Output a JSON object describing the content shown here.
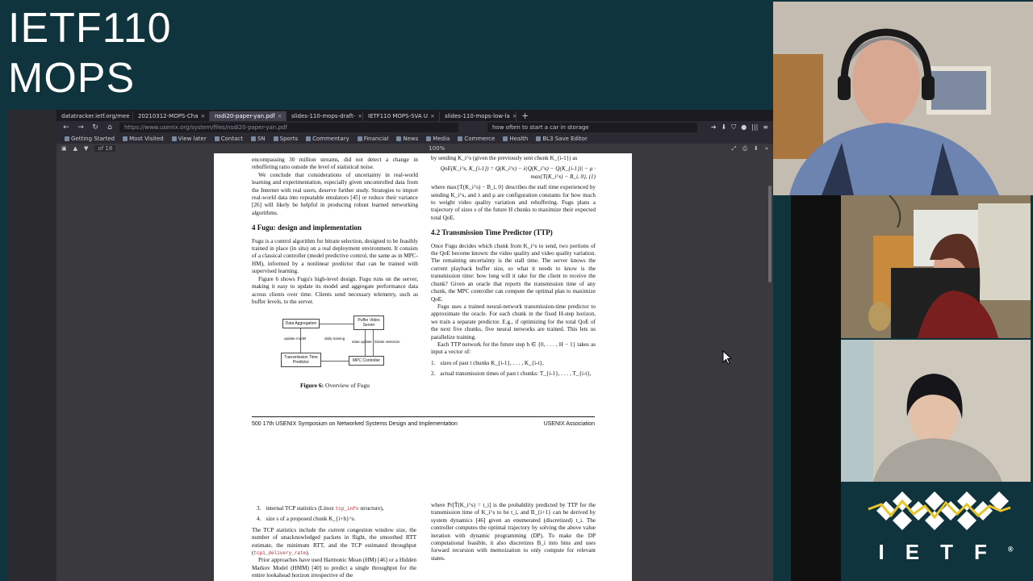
{
  "meeting": {
    "title_line1": "IETF110",
    "title_line2": "MOPS"
  },
  "browser": {
    "tabs": [
      {
        "label": "datatracker.ietf.org/mee",
        "active": false
      },
      {
        "label": "20210312-MOPS-Cha",
        "active": false
      },
      {
        "label": "nsdi20-paper-yan.pdf",
        "active": true
      },
      {
        "label": "slides-110-mops-draft-",
        "active": false
      },
      {
        "label": "IETF110 MOPS-SVA U",
        "active": false
      },
      {
        "label": "slides-110-mops-low-la",
        "active": false
      }
    ],
    "new_tab": "+",
    "url": "https://www.usenix.org/system/files/nsdi20-paper-yan.pdf",
    "search": "how often to start a car in storage",
    "bookmarks": [
      "Getting Started",
      "Most Visited",
      "View later",
      "Contact",
      "SN",
      "Sports",
      "Commentary",
      "Financial",
      "News",
      "Media",
      "Commerce",
      "Health",
      "BL3 Save Editor"
    ],
    "pdf_page": "of 18",
    "zoom": "100%"
  },
  "paper": {
    "left_intro": "encompassing 30 million streams, did not detect a change in rebuffering ratio outside the level of statistical noise.",
    "left_p1": "We conclude that considerations of uncertainty in real-world learning and experimentation, especially given uncontrolled data from the Internet with real users, deserve further study. Strategies to import real-world data into repeatable emulators [45] or reduce their variance [26] will likely be helpful in producing robust learned networking algorithms.",
    "section4": "4   Fugu: design and implementation",
    "left_p2": "Fugu is a control algorithm for bitrate selection, designed to be feasibly trained in place (in situ) on a real deployment environment. It consists of a classical controller (model predictive control, the same as in MPC-HM), informed by a nonlinear predictor that can be trained with supervised learning.",
    "left_p3": "Figure 6 shows Fugu's high-level design. Fugu runs on the server, making it easy to update its model and aggregate performance data across clients over time. Clients send necessary telemetry, such as buffer levels, to the server.",
    "figure": {
      "box_data": "Data Aggregation",
      "box_puffer": "Puffer Video Server",
      "box_ttp": "Transmission Time Predictor",
      "box_mpc": "MPC Controller",
      "lbl_update": "update model",
      "lbl_state": "state update",
      "lbl_select": "bitrate selection",
      "lbl_daily": "daily training",
      "caption_bold": "Figure 6:",
      "caption": " Overview of Fugu"
    },
    "right_top": "by sending K_i^s (given the previously sent chunk K_{i-1}) as",
    "equation": "QoE(K_i^s, K_{i-1}) = Q(K_i^s) − λ|Q(K_i^s) − Q(K_{i-1})| − μ · max{T(K_i^s) − B_i, 0},",
    "equation_no": "(1)",
    "right_p1": "where max{T(K_i^s) − B_i, 0} describes the stall time experienced by sending K_i^s, and λ and μ are configuration constants for how much to weight video quality variation and rebuffering. Fugu plans a trajectory of sizes s of the future H chunks to maximize their expected total QoE.",
    "section42": "4.2   Transmission Time Predictor (TTP)",
    "right_p2": "Once Fugu decides which chunk from K_i^s to send, two portions of the QoE become known: the video quality and video quality variation. The remaining uncertainty is the stall time. The server knows the current playback buffer size, so what it needs to know is the transmission time: how long will it take for the client to receive the chunk? Given an oracle that reports the transmission time of any chunk, the MPC controller can compute the optimal plan to maximize QoE.",
    "right_p3": "Fugu uses a trained neural-network transmission-time predictor to approximate the oracle. For each chunk in the fixed H-step horizon, we train a separate predictor. E.g., if optimizing for the total QoE of the next five chunks, five neural networks are trained. This lets us parallelize training.",
    "right_p4": "Each TTP network for the future step h ∈ {0, . . . , H − 1} takes as input a vector of:",
    "list1": "sizes of past t chunks K_{i-1}, . . . , K_{i-t},",
    "list2": "actual transmission times of past t chunks: T_{i-1}, . . . , T_{i-t},",
    "footer_left": "500   17th USENIX Symposium on Networked Systems Design and Implementation",
    "footer_right": "USENIX Association",
    "p2_list3_a": "internal TCP statistics (Linux ",
    "p2_list3_mono": "tcp_info",
    "p2_list3_b": " structure),",
    "p2_list4": "size s of a proposed chunk K_{i+h}^s.",
    "p2_left_p1": "The TCP statistics include the current congestion window size, the number of unacknowledged packets in flight, the smoothed RTT estimate, the minimum RTT, and the TCP estimated throughput (",
    "p2_left_mono": "tcpi_delivery_rate",
    "p2_left_p1b": ").",
    "p2_left_p2": "Prior approaches have used Harmonic Mean (HM) [46] or a Hidden Markov Model (HMM) [40] to predict a single throughput for the entire lookahead horizon irrespective of the",
    "p2_right_p1": "where Pr[T̂(K_i^s) = t_i] is the probability predicted by TTP for the transmission time of K_i^s to be t_i, and B_{i+1} can be derived by system dynamics [46] given an enumerated (discretized) t_i. The controller computes the optimal trajectory by solving the above value iteration with dynamic programming (DP). To make the DP computational feasible, it also discretizes B_i into bins and uses forward recursion with memoization to only compute for relevant states."
  },
  "logo": {
    "text": "IETF",
    "mark": "®"
  },
  "colors": {
    "background": "#10343d",
    "logo_line": "#e8c32a",
    "logo_diamond": "#ffffff",
    "link": "#c2272d"
  }
}
